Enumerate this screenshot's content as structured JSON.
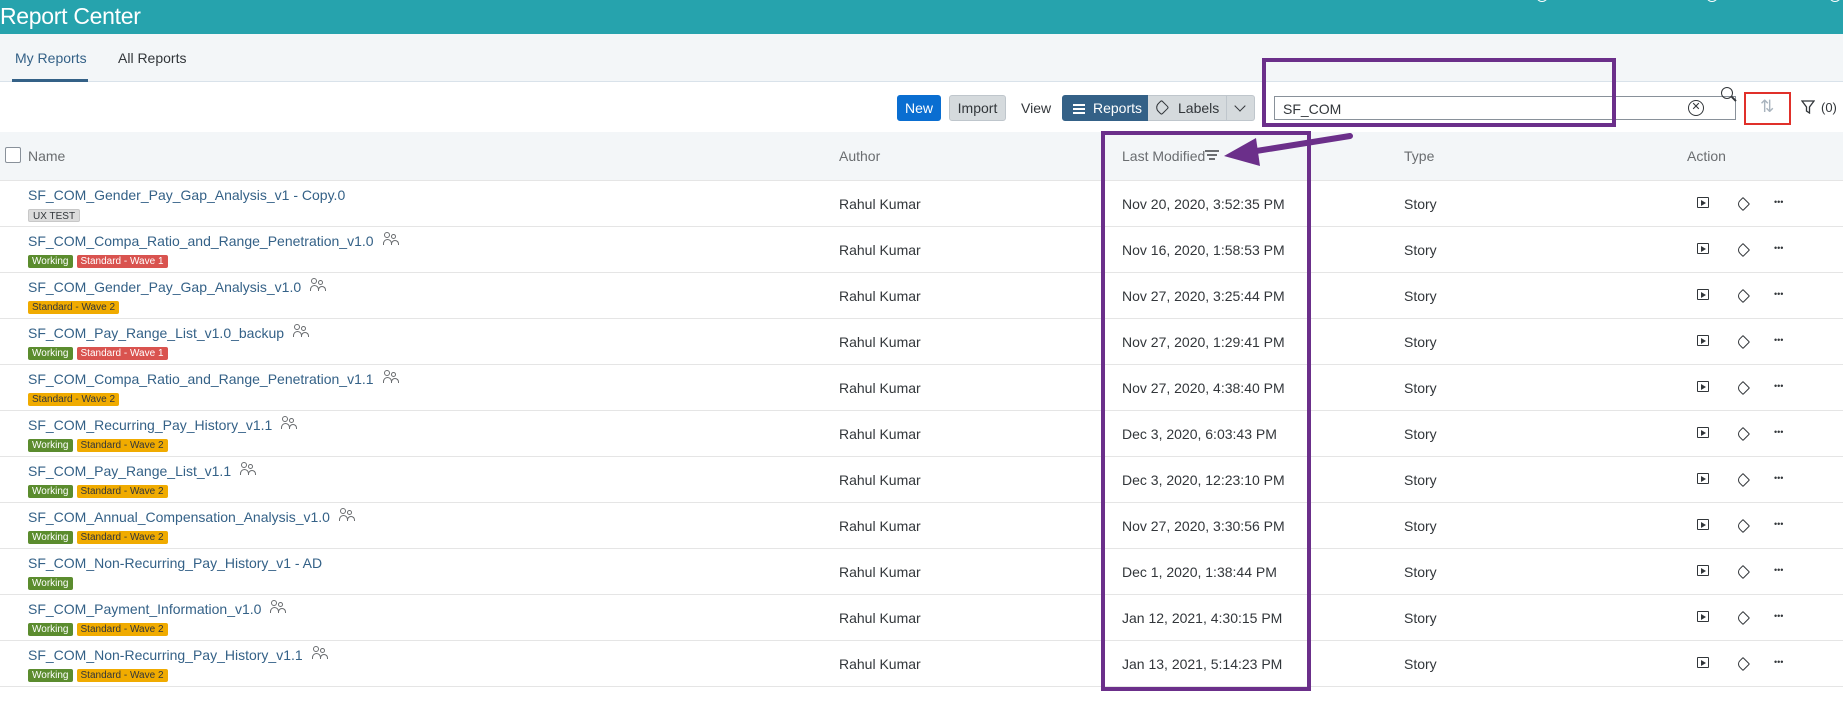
{
  "shell": {
    "title": "Report Center"
  },
  "tabs": [
    {
      "label": "My Reports",
      "active": true
    },
    {
      "label": "All Reports",
      "active": false
    }
  ],
  "toolbar": {
    "new_label": "New",
    "import_label": "Import",
    "view_label": "View",
    "reports_label": "Reports",
    "labels_label": "Labels",
    "search_value": "SF_COM",
    "filter_count": "(0)"
  },
  "columns": {
    "name": "Name",
    "author": "Author",
    "last_modified": "Last Modified",
    "type": "Type",
    "action": "Action"
  },
  "colors": {
    "header": "#26a3ad",
    "link": "#346187",
    "working": "#5b8c2e",
    "wave1": "#d9534f",
    "wave2": "#f0ab00",
    "annotation_purple": "#6b2f8a",
    "annotation_red": "#e0302a"
  },
  "rows": [
    {
      "name": "SF_COM_Gender_Pay_Gap_Analysis_v1 - Copy.0",
      "shared": false,
      "badges": [
        {
          "text": "UX TEST",
          "kind": "ux"
        }
      ],
      "author": "Rahul Kumar",
      "modified": "Nov 20, 2020, 3:52:35 PM",
      "type": "Story"
    },
    {
      "name": "SF_COM_Compa_Ratio_and_Range_Penetration_v1.0",
      "shared": true,
      "badges": [
        {
          "text": "Working",
          "kind": "working"
        },
        {
          "text": "Standard - Wave 1",
          "kind": "wave1"
        }
      ],
      "author": "Rahul Kumar",
      "modified": "Nov 16, 2020, 1:58:53 PM",
      "type": "Story"
    },
    {
      "name": "SF_COM_Gender_Pay_Gap_Analysis_v1.0",
      "shared": true,
      "badges": [
        {
          "text": "Standard - Wave 2",
          "kind": "wave2"
        }
      ],
      "author": "Rahul Kumar",
      "modified": "Nov 27, 2020, 3:25:44 PM",
      "type": "Story"
    },
    {
      "name": "SF_COM_Pay_Range_List_v1.0_backup",
      "shared": true,
      "badges": [
        {
          "text": "Working",
          "kind": "working"
        },
        {
          "text": "Standard - Wave 1",
          "kind": "wave1"
        }
      ],
      "author": "Rahul Kumar",
      "modified": "Nov 27, 2020, 1:29:41 PM",
      "type": "Story"
    },
    {
      "name": "SF_COM_Compa_Ratio_and_Range_Penetration_v1.1",
      "shared": true,
      "badges": [
        {
          "text": "Standard - Wave 2",
          "kind": "wave2"
        }
      ],
      "author": "Rahul Kumar",
      "modified": "Nov 27, 2020, 4:38:40 PM",
      "type": "Story"
    },
    {
      "name": "SF_COM_Recurring_Pay_History_v1.1",
      "shared": true,
      "badges": [
        {
          "text": "Working",
          "kind": "working"
        },
        {
          "text": "Standard - Wave 2",
          "kind": "wave2"
        }
      ],
      "author": "Rahul Kumar",
      "modified": "Dec 3, 2020, 6:03:43 PM",
      "type": "Story"
    },
    {
      "name": "SF_COM_Pay_Range_List_v1.1",
      "shared": true,
      "badges": [
        {
          "text": "Working",
          "kind": "working"
        },
        {
          "text": "Standard - Wave 2",
          "kind": "wave2"
        }
      ],
      "author": "Rahul Kumar",
      "modified": "Dec 3, 2020, 12:23:10 PM",
      "type": "Story"
    },
    {
      "name": "SF_COM_Annual_Compensation_Analysis_v1.0",
      "shared": true,
      "badges": [
        {
          "text": "Working",
          "kind": "working"
        },
        {
          "text": "Standard - Wave 2",
          "kind": "wave2"
        }
      ],
      "author": "Rahul Kumar",
      "modified": "Nov 27, 2020, 3:30:56 PM",
      "type": "Story"
    },
    {
      "name": "SF_COM_Non-Recurring_Pay_History_v1 - AD",
      "shared": false,
      "badges": [
        {
          "text": "Working",
          "kind": "working"
        }
      ],
      "author": "Rahul Kumar",
      "modified": "Dec 1, 2020, 1:38:44 PM",
      "type": "Story"
    },
    {
      "name": "SF_COM_Payment_Information_v1.0",
      "shared": true,
      "badges": [
        {
          "text": "Working",
          "kind": "working"
        },
        {
          "text": "Standard - Wave 2",
          "kind": "wave2"
        }
      ],
      "author": "Rahul Kumar",
      "modified": "Jan 12, 2021, 4:30:15 PM",
      "type": "Story"
    },
    {
      "name": "SF_COM_Non-Recurring_Pay_History_v1.1",
      "shared": true,
      "badges": [
        {
          "text": "Working",
          "kind": "working"
        },
        {
          "text": "Standard - Wave 2",
          "kind": "wave2"
        }
      ],
      "author": "Rahul Kumar",
      "modified": "Jan 13, 2021, 5:14:23 PM",
      "type": "Story"
    }
  ]
}
